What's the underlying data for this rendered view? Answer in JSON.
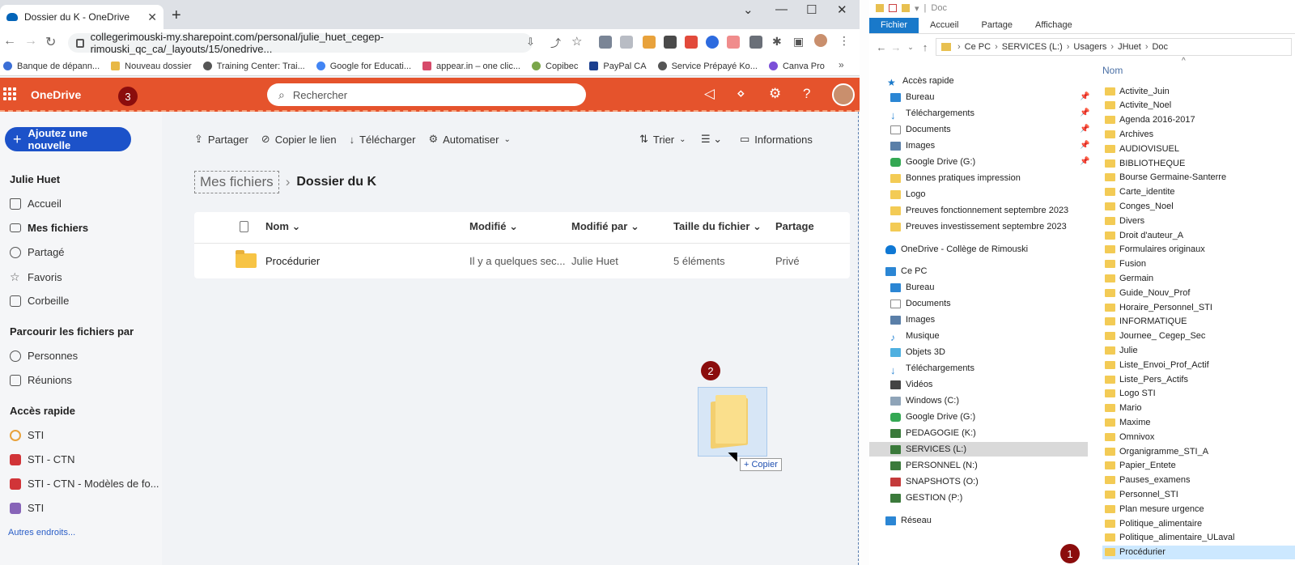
{
  "browser": {
    "tab_title": "Dossier du K - OneDrive",
    "url": "collegerimouski-my.sharepoint.com/personal/julie_huet_cegep-rimouski_qc_ca/_layouts/15/onedrive...",
    "bookmarks": [
      "Banque de dépann...",
      "Nouveau dossier",
      "Training Center: Trai...",
      "Google for Educati...",
      "appear.in – one clic...",
      "Copibec",
      "PayPal CA",
      "Service Prépayé Ko...",
      "Canva Pro"
    ]
  },
  "onedrive": {
    "brand": "OneDrive",
    "search_placeholder": "Rechercher",
    "add_button": "Ajoutez une nouvelle",
    "user": "Julie Huet",
    "nav": [
      "Accueil",
      "Mes fichiers",
      "Partagé",
      "Favoris",
      "Corbeille"
    ],
    "browse_header": "Parcourir les fichiers par",
    "browse": [
      "Personnes",
      "Réunions"
    ],
    "quick_header": "Accès rapide",
    "quick": [
      "STI",
      "STI - CTN",
      "STI - CTN - Modèles de fo...",
      "STI"
    ],
    "more_places": "Autres endroits...",
    "commands": [
      "Partager",
      "Copier le lien",
      "Télécharger",
      "Automatiser"
    ],
    "sort": "Trier",
    "info": "Informations",
    "breadcrumb": [
      "Mes fichiers",
      "Dossier du K"
    ],
    "columns": [
      "Nom",
      "Modifié",
      "Modifié par",
      "Taille du fichier",
      "Partage"
    ],
    "rows": [
      {
        "name": "Procédurier",
        "modified": "Il y a quelques sec...",
        "by": "Julie Huet",
        "size": "5 éléments",
        "share": "Privé"
      }
    ],
    "drag_label": "+ Copier"
  },
  "badges": [
    "1",
    "2",
    "3"
  ],
  "explorer": {
    "title": "Doc",
    "ribbon": [
      "Fichier",
      "Accueil",
      "Partage",
      "Affichage"
    ],
    "path": [
      "Ce PC",
      "SERVICES (L:)",
      "Usagers",
      "JHuet",
      "Doc"
    ],
    "tree": [
      "Accès rapide",
      "Bureau",
      "Téléchargements",
      "Documents",
      "Images",
      "Google Drive (G:)",
      "Bonnes pratiques impression",
      "Logo",
      "Preuves fonctionnement septembre 2023",
      "Preuves investissement septembre 2023",
      "OneDrive - Collège de Rimouski",
      "Ce PC",
      "Bureau",
      "Documents",
      "Images",
      "Musique",
      "Objets 3D",
      "Téléchargements",
      "Vidéos",
      "Windows (C:)",
      "Google Drive (G:)",
      "PEDAGOGIE (K:)",
      "SERVICES (L:)",
      "PERSONNEL (N:)",
      "SNAPSHOTS (O:)",
      "GESTION (P:)",
      "Réseau"
    ],
    "column_name": "Nom",
    "files": [
      "Activite_Juin",
      "Activite_Noel",
      "Agenda 2016-2017",
      "Archives",
      "AUDIOVISUEL",
      "BIBLIOTHEQUE",
      "Bourse Germaine-Santerre",
      "Carte_identite",
      "Conges_Noel",
      "Divers",
      "Droit d'auteur_A",
      "Formulaires originaux",
      "Fusion",
      "Germain",
      "Guide_Nouv_Prof",
      "Horaire_Personnel_STI",
      "INFORMATIQUE",
      "Journee_ Cegep_Sec",
      "Julie",
      "Liste_Envoi_Prof_Actif",
      "Liste_Pers_Actifs",
      "Logo STI",
      "Mario",
      "Maxime",
      "Omnivox",
      "Organigramme_STI_A",
      "Papier_Entete",
      "Pauses_examens",
      "Personnel_STI",
      "Plan mesure urgence",
      "Politique_alimentaire",
      "Politique_alimentaire_ULaval",
      "Procédurier"
    ]
  },
  "colors": {
    "onedrive_orange": "#e5532c",
    "accent_blue": "#1c52c9",
    "badge": "#8b0d0d"
  }
}
